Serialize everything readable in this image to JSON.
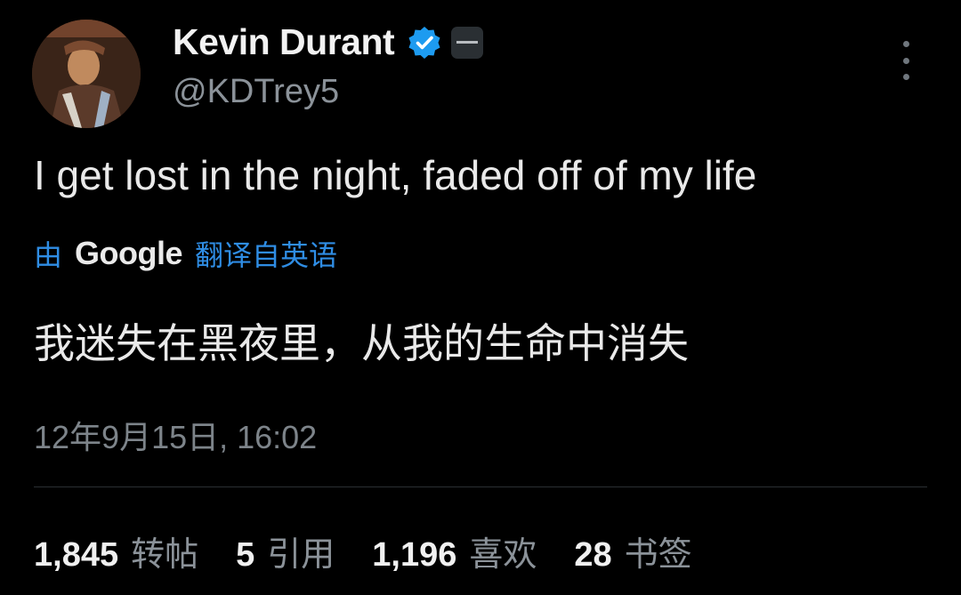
{
  "user": {
    "display_name": "Kevin Durant",
    "handle": "@KDTrey5",
    "verified_color": "#1d9bf0"
  },
  "tweet": {
    "text": "I get lost in the night, faded off of my life",
    "translation_prefix": "由",
    "translation_provider": "Google",
    "translation_suffix": "翻译自英语",
    "translated_text": "我迷失在黑夜里，从我的生命中消失",
    "timestamp": "12年9月15日, 16:02"
  },
  "stats": [
    {
      "count": "1,845",
      "label": "转帖"
    },
    {
      "count": "5",
      "label": "引用"
    },
    {
      "count": "1,196",
      "label": "喜欢"
    },
    {
      "count": "28",
      "label": "书签"
    }
  ],
  "icons": {
    "verified": "verified-badge-icon",
    "affiliate": "affiliate-badge-icon",
    "more": "more-options-icon"
  }
}
